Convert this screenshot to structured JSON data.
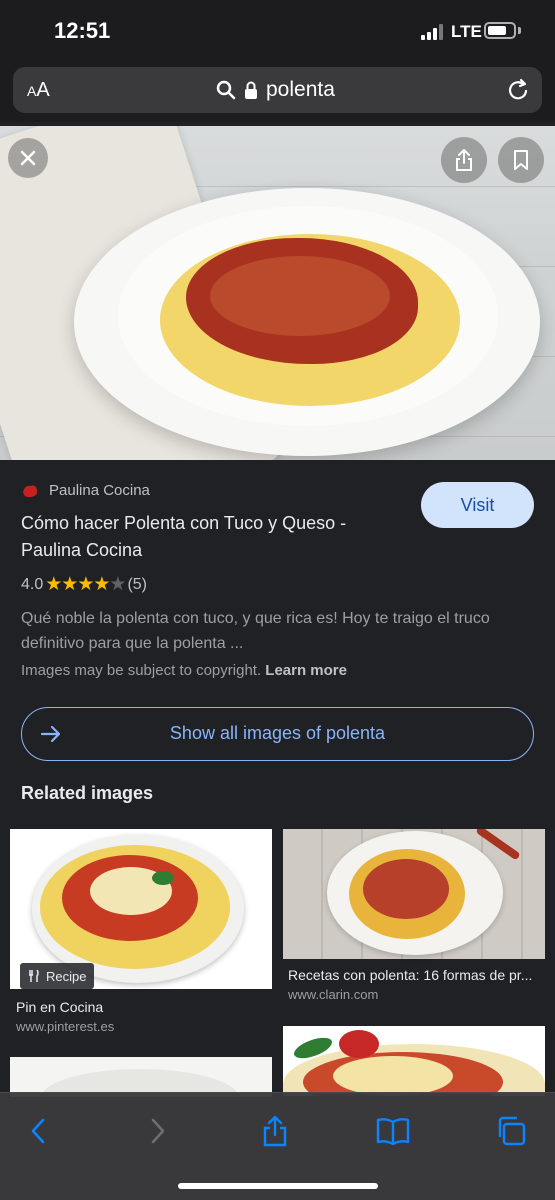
{
  "status": {
    "time": "12:51",
    "network": "LTE"
  },
  "url_bar": {
    "text_size_label": "AA",
    "url": "polenta"
  },
  "result": {
    "source": "Paulina Cocina",
    "title": "Cómo hacer Polenta con Tuco y Queso - Paulina Cocina",
    "rating_value": "4.0",
    "rating_count": "(5)",
    "description": "Qué noble la polenta con tuco, y que rica es! Hoy te traigo el truco definitivo para que la polenta ...",
    "copyright_text": "Images may be subject to copyright.",
    "learn_more": "Learn more",
    "visit_label": "Visit"
  },
  "show_all_label": "Show all images of polenta",
  "related": {
    "heading": "Related images",
    "items": [
      {
        "title": "Pin en Cocina",
        "domain": "www.pinterest.es",
        "badge": "Recipe"
      },
      {
        "title": "Recetas con polenta: 16 formas de pr...",
        "domain": "www.clarin.com"
      }
    ]
  },
  "colors": {
    "accent_blue": "#8ab4f8",
    "visit_bg": "#d2e3fc",
    "star": "#fbbc04",
    "toolbar_icon": "#0a84ff"
  }
}
